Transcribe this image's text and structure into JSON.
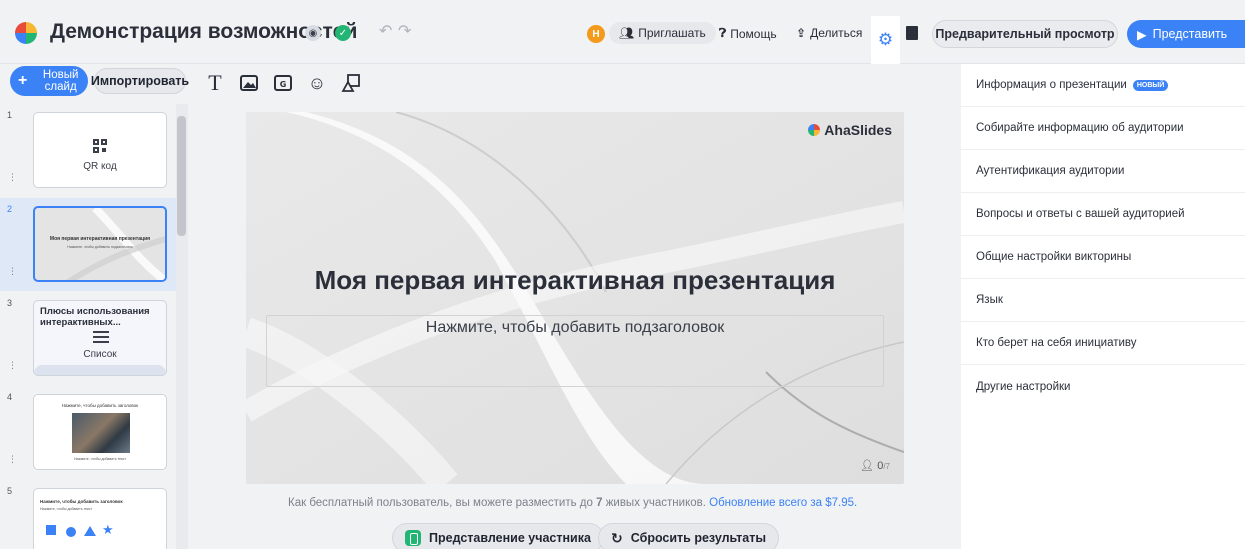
{
  "header": {
    "title": "Демонстрация возможностей",
    "avatar_initial": "H",
    "invite_label": "Приглашать",
    "help_label": "Помощь",
    "share_label": "Делиться",
    "preview_label": "Предварительный просмотр",
    "present_label": "Представить"
  },
  "sidebar": {
    "new_slide_label": "Новый слайд",
    "import_label": "Импортировать",
    "slides": [
      {
        "num": "1",
        "label": "QR код"
      },
      {
        "num": "2",
        "title": "Моя первая интерактивная презентация",
        "sub": "Нажмите, чтобы добавить подзаголовок"
      },
      {
        "num": "3",
        "title": "Плюсы использования интерактивных...",
        "label": "Список"
      },
      {
        "num": "4",
        "title": "Нажмите, чтобы добавить заголовок",
        "sub": "Нажмите, чтобы добавить текст"
      },
      {
        "num": "5",
        "title": "Нажмите, чтобы добавить заголовок",
        "sub": "Нажмите, чтобы добавить текст"
      }
    ]
  },
  "slide": {
    "brand": "AhaSlides",
    "title": "Моя первая интерактивная презентация",
    "subtitle": "Нажмите, чтобы добавить подзаголовок",
    "participants": "0"
  },
  "footer": {
    "note_before": "Как бесплатный пользователь, вы можете разместить до ",
    "note_count": "7",
    "note_after": " живых участников. ",
    "upgrade_link": "Обновление всего за $7.95.",
    "participant_view_label": "Представление участника",
    "reset_label": "Сбросить результаты"
  },
  "settings_panel": {
    "items": [
      {
        "label": "Информация о презентации",
        "badge": "НОВЫЙ"
      },
      {
        "label": "Собирайте информацию об аудитории"
      },
      {
        "label": "Аутентификация аудитории"
      },
      {
        "label": "Вопросы и ответы с вашей аудиторией"
      },
      {
        "label": "Общие настройки викторины"
      },
      {
        "label": "Язык"
      },
      {
        "label": "Кто берет на себя инициативу"
      },
      {
        "label": "Другие настройки"
      }
    ]
  },
  "colors": {
    "accent": "#3b82f6",
    "avatar": "#f39a1c",
    "green": "#22b573"
  }
}
